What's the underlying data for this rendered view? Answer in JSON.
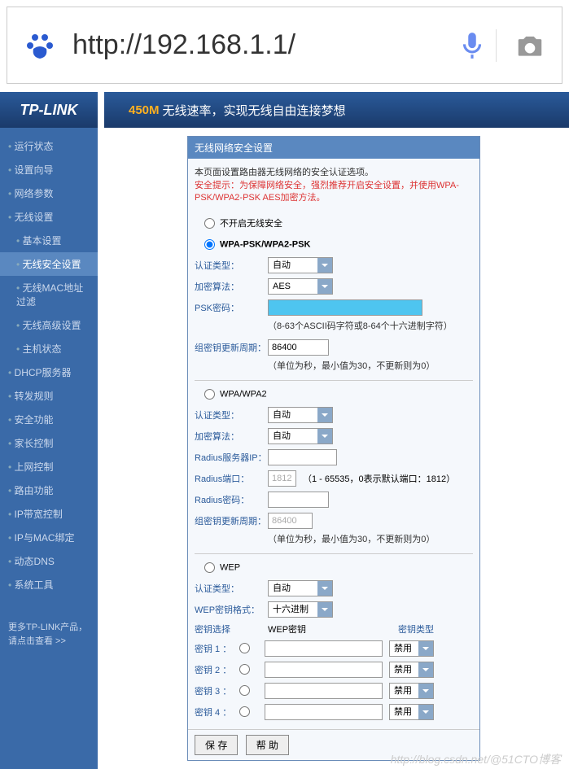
{
  "url": "http://192.168.1.1/",
  "logo": "TP-LINK",
  "banner": {
    "gold": "450M",
    "text": "无线速率，实现无线自由连接梦想"
  },
  "sidebar": {
    "items": [
      "运行状态",
      "设置向导",
      "网络参数",
      "无线设置",
      "基本设置",
      "无线安全设置",
      "无线MAC地址过滤",
      "无线高级设置",
      "主机状态",
      "DHCP服务器",
      "转发规则",
      "安全功能",
      "家长控制",
      "上网控制",
      "路由功能",
      "IP带宽控制",
      "IP与MAC绑定",
      "动态DNS",
      "系统工具"
    ],
    "footer1": "更多TP-LINK产品，",
    "footer2": "请点击查看 >>"
  },
  "panel": {
    "title": "无线网络安全设置",
    "desc": "本页面设置路由器无线网络的安全认证选项。",
    "warn": "安全提示：为保障网络安全，强烈推荐开启安全设置，并使用WPA-PSK/WPA2-PSK AES加密方法。",
    "opt_none": "不开启无线安全",
    "opt_wpapsk": "WPA-PSK/WPA2-PSK",
    "opt_wpa": "WPA/WPA2",
    "opt_wep": "WEP",
    "lbl_authtype": "认证类型：",
    "lbl_enc": "加密算法：",
    "lbl_psk": "PSK密码：",
    "lbl_gk": "组密钥更新周期：",
    "lbl_radius_ip": "Radius服务器IP：",
    "lbl_radius_port": "Radius端口：",
    "lbl_radius_pwd": "Radius密码：",
    "lbl_wep_fmt": "WEP密钥格式：",
    "lbl_key_sel": "密钥选择",
    "lbl_wep_key": "WEP密钥",
    "lbl_key_type": "密钥类型",
    "val_auto": "自动",
    "val_aes": "AES",
    "val_hex": "十六进制",
    "val_disabled": "禁用",
    "val_gk": "86400",
    "val_radius_port": "1812",
    "val_radius_gk": "86400",
    "hint_psk": "（8-63个ASCII码字符或8-64个十六进制字符）",
    "hint_gk": "（单位为秒，最小值为30，不更新则为0）",
    "hint_port": "（1 - 65535，0表示默认端口：1812）",
    "key1": "密钥 1 ：",
    "key2": "密钥 2 ：",
    "key3": "密钥 3 ：",
    "key4": "密钥 4 ：",
    "btn_save": "保 存",
    "btn_help": "帮 助"
  },
  "watermark": "http://blog.csdn.net/@51CTO博客"
}
